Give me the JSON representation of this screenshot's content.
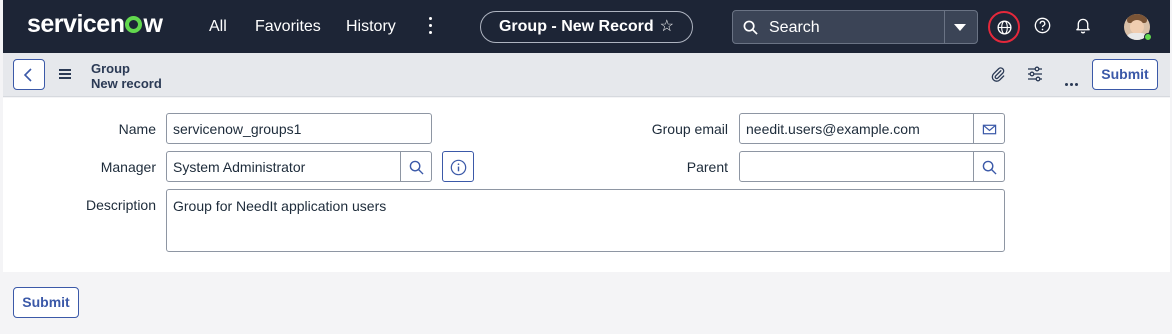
{
  "nav": {
    "logo_text_a": "servicen",
    "logo_text_b": "w",
    "links": [
      "All",
      "Favorites",
      "History"
    ],
    "context_title": "Group - New Record",
    "context_star": "☆",
    "search_placeholder": "Search"
  },
  "header": {
    "title_line1": "Group",
    "title_line2": "New record",
    "submit_label": "Submit"
  },
  "form": {
    "name": {
      "label": "Name",
      "value": "servicenow_groups1"
    },
    "manager": {
      "label": "Manager",
      "value": "System Administrator"
    },
    "description": {
      "label": "Description",
      "value": "Group for NeedIt application users"
    },
    "group_email": {
      "label": "Group email",
      "value": "needit.users@example.com"
    },
    "parent": {
      "label": "Parent",
      "value": ""
    }
  },
  "footer": {
    "submit_label": "Submit"
  },
  "colors": {
    "nav_bg": "#1d2536",
    "accent": "#3b59a8",
    "logo_green": "#62d84e",
    "globe_ring": "#e4283b"
  },
  "icons": [
    "chevron-left-icon",
    "hamburger-icon",
    "paperclip-icon",
    "sliders-icon",
    "more-icon",
    "search-icon",
    "info-icon",
    "mail-icon",
    "globe-icon",
    "help-icon",
    "bell-icon",
    "caret-down-icon",
    "star-icon"
  ]
}
